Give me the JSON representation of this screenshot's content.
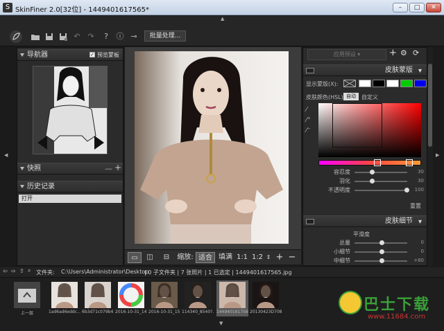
{
  "window": {
    "title": "SkinFiner 2.0[32位] - 1449401617565*",
    "app_icon": "S",
    "minimize": "–",
    "maximize": "□",
    "close": "✕"
  },
  "toolbar": {
    "batch_label": "批量处理..."
  },
  "navigator": {
    "title": "导航器",
    "preview_mask_label": "预览蒙板"
  },
  "snapshot": {
    "title": "快照"
  },
  "history": {
    "title": "历史记录",
    "items": [
      "打开"
    ]
  },
  "zoom": {
    "label": "缩放:",
    "fit": "适合",
    "fill": "填满",
    "one_to_one": "1:1",
    "one_to_two": "1:2"
  },
  "preset": {
    "label": "应用预设"
  },
  "skin_mask": {
    "title": "皮肤蒙版",
    "show_mask_label": "显示蒙版(X):",
    "skin_color_label": "皮肤颜色(HSL):",
    "auto_label": "自动",
    "custom_label": "自定义",
    "swatches": [
      "#ffffff",
      "#000000",
      "#ffffff",
      "#00cc00",
      "#0000ee"
    ],
    "sliders": [
      {
        "label": "容忍度",
        "value": "30",
        "level": 0.3
      },
      {
        "label": "羽化",
        "value": "30",
        "level": 0.3
      },
      {
        "label": "不透明度",
        "value": "100",
        "level": 1.0
      }
    ],
    "reset_label": "重置"
  },
  "skin_detail": {
    "title": "皮肤细节",
    "section_label": "平滑度",
    "sliders": [
      {
        "label": "总量",
        "value": "0",
        "level": 0.5
      },
      {
        "label": "小细节",
        "value": "0",
        "level": 0.5
      },
      {
        "label": "中细节",
        "value": "+80",
        "level": 0.5
      }
    ]
  },
  "pathbar": {
    "label": "文件夹:",
    "path": "C:\\Users\\Administrator\\Desktop",
    "info": "| 0 子文件夹 | 7 张照片 | 1 已选定 | 1449401617565.jpg"
  },
  "filmstrip": {
    "items": [
      {
        "caption": "上一层"
      },
      {
        "caption": "1ad6ad6eddc..."
      },
      {
        "caption": "6b3d71c079b4..."
      },
      {
        "caption": "2016-10-31_14..."
      },
      {
        "caption": "2016-10-31_15..."
      },
      {
        "caption": "114340_8540?..."
      },
      {
        "caption": "1449401617S6..."
      },
      {
        "caption": "20130423D708..."
      }
    ]
  },
  "watermark": {
    "title": "巴士下载",
    "url": "www.11684.com"
  },
  "colors": {
    "accent_red": "#ff0000",
    "green": "#3aa039"
  }
}
